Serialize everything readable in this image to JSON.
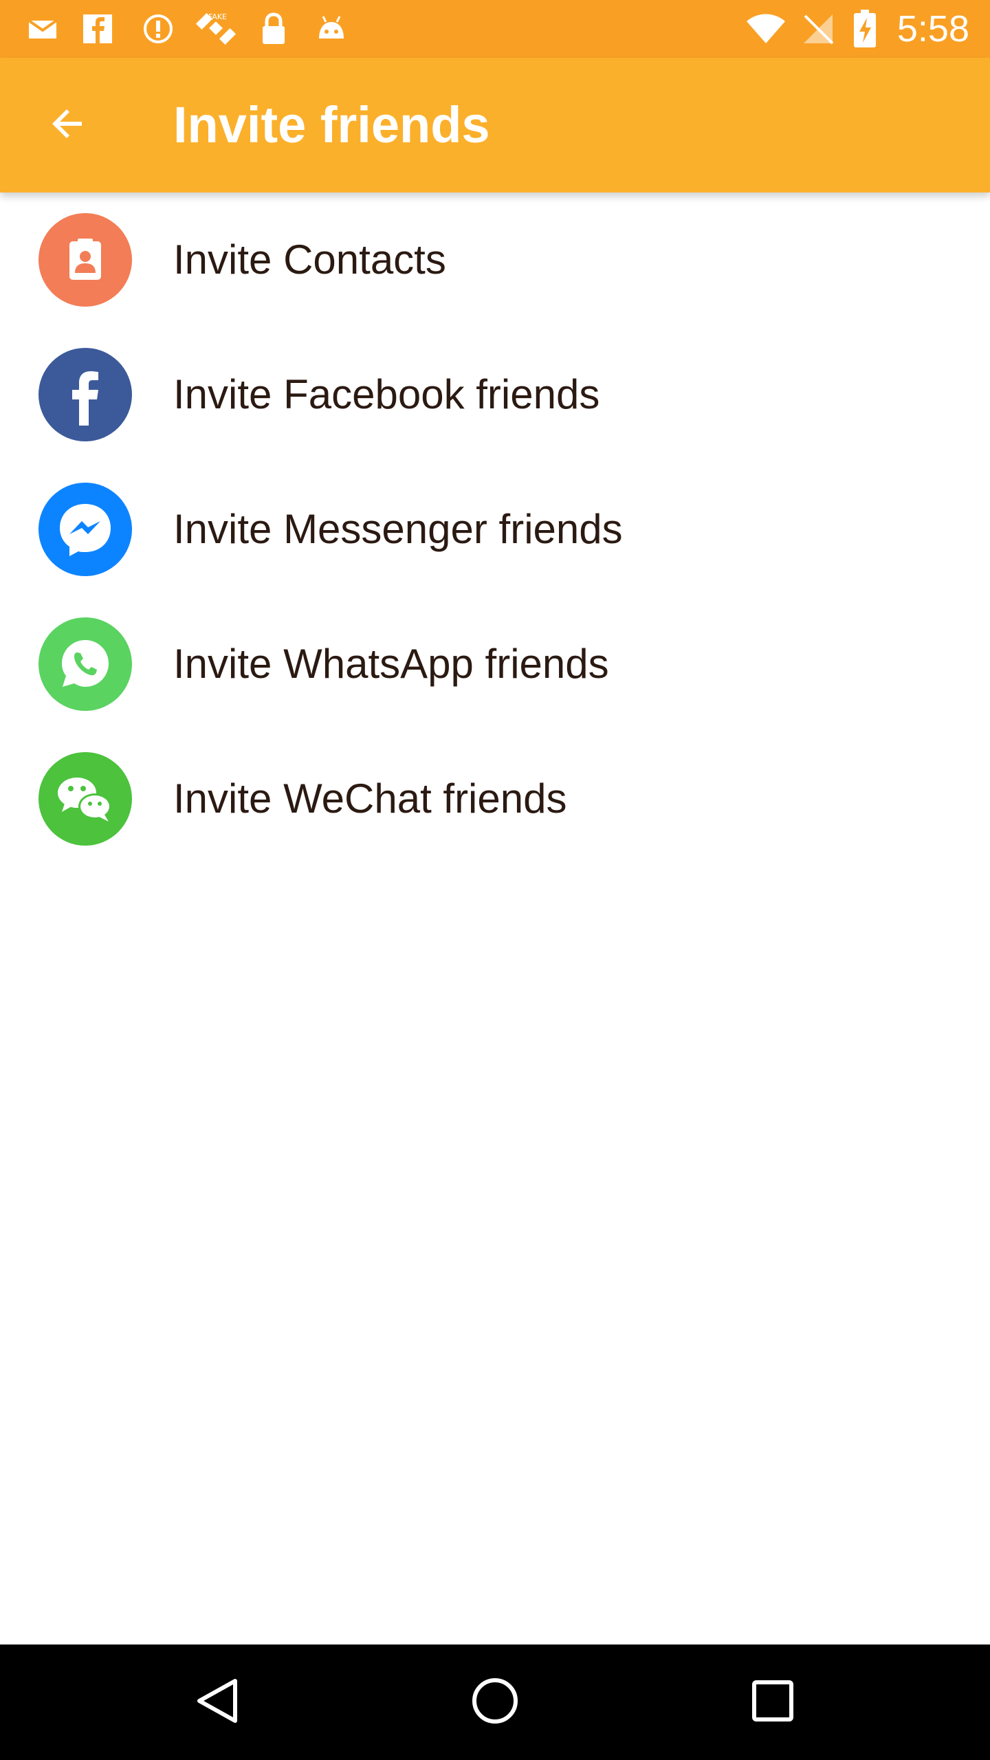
{
  "status_bar": {
    "time": "5:58",
    "left_icons": [
      "mail-icon",
      "facebook-icon",
      "alert-icon",
      "satellite-icon",
      "lock-icon",
      "android-icon"
    ],
    "right_icons": [
      "wifi-icon",
      "no-signal-icon",
      "battery-charging-icon"
    ]
  },
  "app_bar": {
    "back_icon": "arrow-back-icon",
    "title": "Invite friends"
  },
  "invite_list": [
    {
      "label": "Invite Contacts",
      "icon": "contacts-icon",
      "color": "#f27d56"
    },
    {
      "label": "Invite Facebook friends",
      "icon": "facebook-icon",
      "color": "#3c5a9a"
    },
    {
      "label": "Invite Messenger friends",
      "icon": "messenger-icon",
      "color": "#0d84ff"
    },
    {
      "label": "Invite WhatsApp friends",
      "icon": "whatsapp-icon",
      "color": "#5ad361"
    },
    {
      "label": "Invite WeChat friends",
      "icon": "wechat-icon",
      "color": "#4cc23d"
    }
  ],
  "colors": {
    "status_bar": "#f9a024",
    "app_bar": "#fbb02b",
    "nav_bar": "#000000",
    "list_text": "#2b1a12"
  },
  "nav_bar": {
    "icons": [
      "back-triangle-icon",
      "home-circle-icon",
      "recents-square-icon"
    ]
  }
}
